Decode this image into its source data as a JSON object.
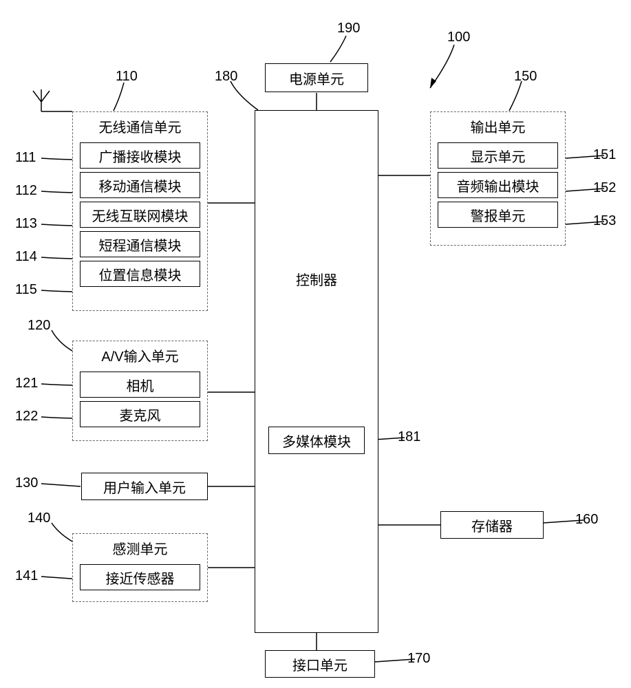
{
  "labels": {
    "n190": "190",
    "n100": "100",
    "n110": "110",
    "n111": "111",
    "n112": "112",
    "n113": "113",
    "n114": "114",
    "n115": "115",
    "n120": "120",
    "n121": "121",
    "n122": "122",
    "n130": "130",
    "n140": "140",
    "n141": "141",
    "n150": "150",
    "n151": "151",
    "n152": "152",
    "n153": "153",
    "n160": "160",
    "n170": "170",
    "n180": "180",
    "n181": "181"
  },
  "blocks": {
    "power": "电源单元",
    "controller": "控制器",
    "multimedia": "多媒体模块",
    "wireless_title": "无线通信单元",
    "broadcast": "广播接收模块",
    "mobile_comm": "移动通信模块",
    "wireless_net": "无线互联网模块",
    "short_range": "短程通信模块",
    "position": "位置信息模块",
    "av_title": "A/V输入单元",
    "camera": "相机",
    "microphone": "麦克风",
    "user_input": "用户输入单元",
    "sensing_title": "感测单元",
    "proximity": "接近传感器",
    "output_title": "输出单元",
    "display": "显示单元",
    "audio_out": "音频输出模块",
    "alarm": "警报单元",
    "memory": "存储器",
    "interface": "接口单元"
  },
  "chart_data": {
    "type": "block-diagram",
    "device_ref": "100",
    "central": {
      "ref": "180",
      "name": "控制器",
      "contains": [
        {
          "ref": "181",
          "name": "多媒体模块"
        }
      ]
    },
    "power": {
      "ref": "190",
      "name": "电源单元"
    },
    "left_units": [
      {
        "ref": "110",
        "name": "无线通信单元",
        "modules": [
          {
            "ref": "111",
            "name": "广播接收模块"
          },
          {
            "ref": "112",
            "name": "移动通信模块"
          },
          {
            "ref": "113",
            "name": "无线互联网模块"
          },
          {
            "ref": "114",
            "name": "短程通信模块"
          },
          {
            "ref": "115",
            "name": "位置信息模块"
          }
        ],
        "has_antenna": true
      },
      {
        "ref": "120",
        "name": "A/V输入单元",
        "modules": [
          {
            "ref": "121",
            "name": "相机"
          },
          {
            "ref": "122",
            "name": "麦克风"
          }
        ]
      },
      {
        "ref": "130",
        "name": "用户输入单元"
      },
      {
        "ref": "140",
        "name": "感测单元",
        "modules": [
          {
            "ref": "141",
            "name": "接近传感器"
          }
        ]
      }
    ],
    "right_units": [
      {
        "ref": "150",
        "name": "输出单元",
        "modules": [
          {
            "ref": "151",
            "name": "显示单元"
          },
          {
            "ref": "152",
            "name": "音频输出模块"
          },
          {
            "ref": "153",
            "name": "警报单元"
          }
        ]
      },
      {
        "ref": "160",
        "name": "存储器"
      }
    ],
    "bottom_units": [
      {
        "ref": "170",
        "name": "接口单元"
      }
    ],
    "connections": [
      [
        "190",
        "180"
      ],
      [
        "110",
        "180"
      ],
      [
        "120",
        "180"
      ],
      [
        "130",
        "180"
      ],
      [
        "140",
        "180"
      ],
      [
        "150",
        "180"
      ],
      [
        "160",
        "180"
      ],
      [
        "170",
        "180"
      ]
    ]
  }
}
